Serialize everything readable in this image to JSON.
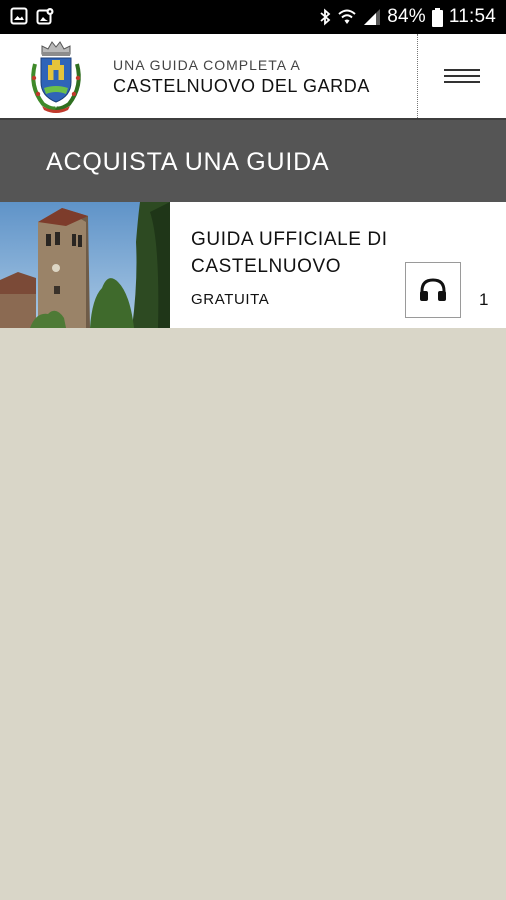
{
  "status_bar": {
    "battery_percent": "84%",
    "time": "11:54",
    "icons": [
      "gallery-icon",
      "photo-location-icon",
      "bluetooth-icon",
      "wifi-icon",
      "signal-icon",
      "battery-icon"
    ]
  },
  "header": {
    "subtitle": "UNA GUIDA COMPLETA A",
    "title": "CASTELNUOVO DEL GARDA",
    "menu_icon": "hamburger-menu-icon"
  },
  "page": {
    "title": "ACQUISTA UNA GUIDA"
  },
  "guides": [
    {
      "title": "GUIDA UFFICIALE DI CASTELNUOVO",
      "price": "GRATUITA",
      "audio_icon": "headphones-icon",
      "count": "1"
    }
  ],
  "colors": {
    "status_bar_bg": "#000000",
    "header_bg": "#ffffff",
    "title_bar_bg": "#555555",
    "page_bg": "#d9d6c8",
    "card_bg": "#ffffff"
  }
}
